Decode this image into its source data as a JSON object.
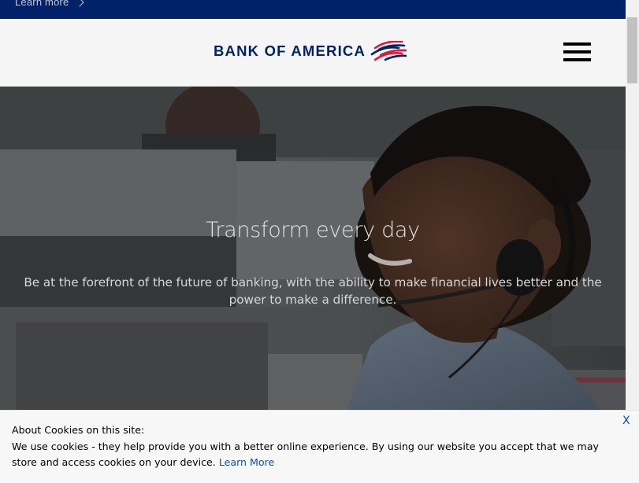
{
  "promo_bar": {
    "link_label": "Learn more",
    "background": "#012169"
  },
  "header": {
    "logo_text": "BANK OF AMERICA",
    "logo_icon": "flag-icon",
    "menu_icon": "hamburger-menu-icon",
    "brand_color": "#012169",
    "flag_red": "#e31837"
  },
  "hero": {
    "title": "Transform every day",
    "subtitle": "Be at the forefront of the future of banking, with the ability to make financial lives better and the power to make a difference."
  },
  "cookie_banner": {
    "heading": "About Cookies on this site:",
    "body": "We use cookies - they help provide you with a better online experience. By using our website you accept that we may store and access cookies on your device.",
    "link_label": "Learn More",
    "close_label": "X",
    "link_color": "#0052c2"
  }
}
